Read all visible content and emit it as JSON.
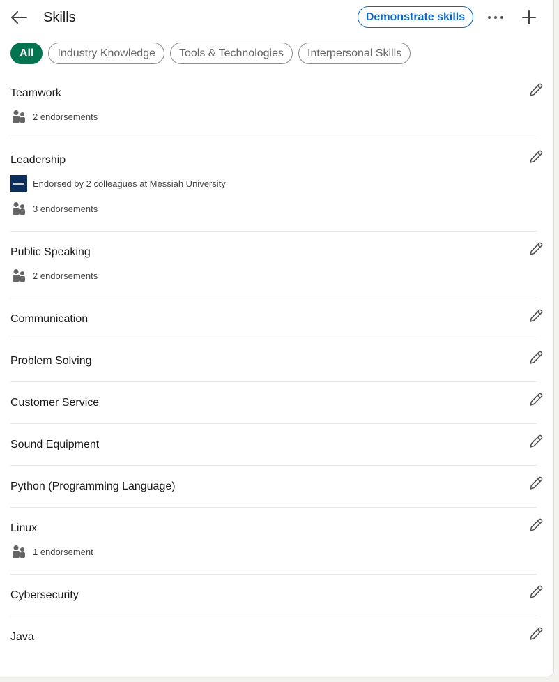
{
  "header": {
    "title": "Skills",
    "demonstrate_label": "Demonstrate skills"
  },
  "filters": [
    "All",
    "Industry Knowledge",
    "Tools & Technologies",
    "Interpersonal Skills"
  ],
  "skills": [
    {
      "name": "Teamwork",
      "endorsed_by": null,
      "endorsements": "2 endorsements"
    },
    {
      "name": "Leadership",
      "endorsed_by": "Endorsed by 2 colleagues at Messiah University",
      "endorsements": "3 endorsements"
    },
    {
      "name": "Public Speaking",
      "endorsed_by": null,
      "endorsements": "2 endorsements"
    },
    {
      "name": "Communication",
      "endorsed_by": null,
      "endorsements": null
    },
    {
      "name": "Problem Solving",
      "endorsed_by": null,
      "endorsements": null
    },
    {
      "name": "Customer Service",
      "endorsed_by": null,
      "endorsements": null
    },
    {
      "name": "Sound Equipment",
      "endorsed_by": null,
      "endorsements": null
    },
    {
      "name": "Python (Programming Language)",
      "endorsed_by": null,
      "endorsements": null
    },
    {
      "name": "Linux",
      "endorsed_by": null,
      "endorsements": "1 endorsement"
    },
    {
      "name": "Cybersecurity",
      "endorsed_by": null,
      "endorsements": null
    },
    {
      "name": "Java",
      "endorsed_by": null,
      "endorsements": null
    }
  ],
  "icons": {
    "back": "arrow-left-icon",
    "more": "ellipsis-icon",
    "add": "plus-icon",
    "edit": "pencil-icon",
    "endorsement": "people-icon",
    "org_logo": "messiah-university-logo"
  },
  "colors": {
    "accent": "#0a66c2",
    "active_chip": "#01754f",
    "icon": "#666666"
  }
}
